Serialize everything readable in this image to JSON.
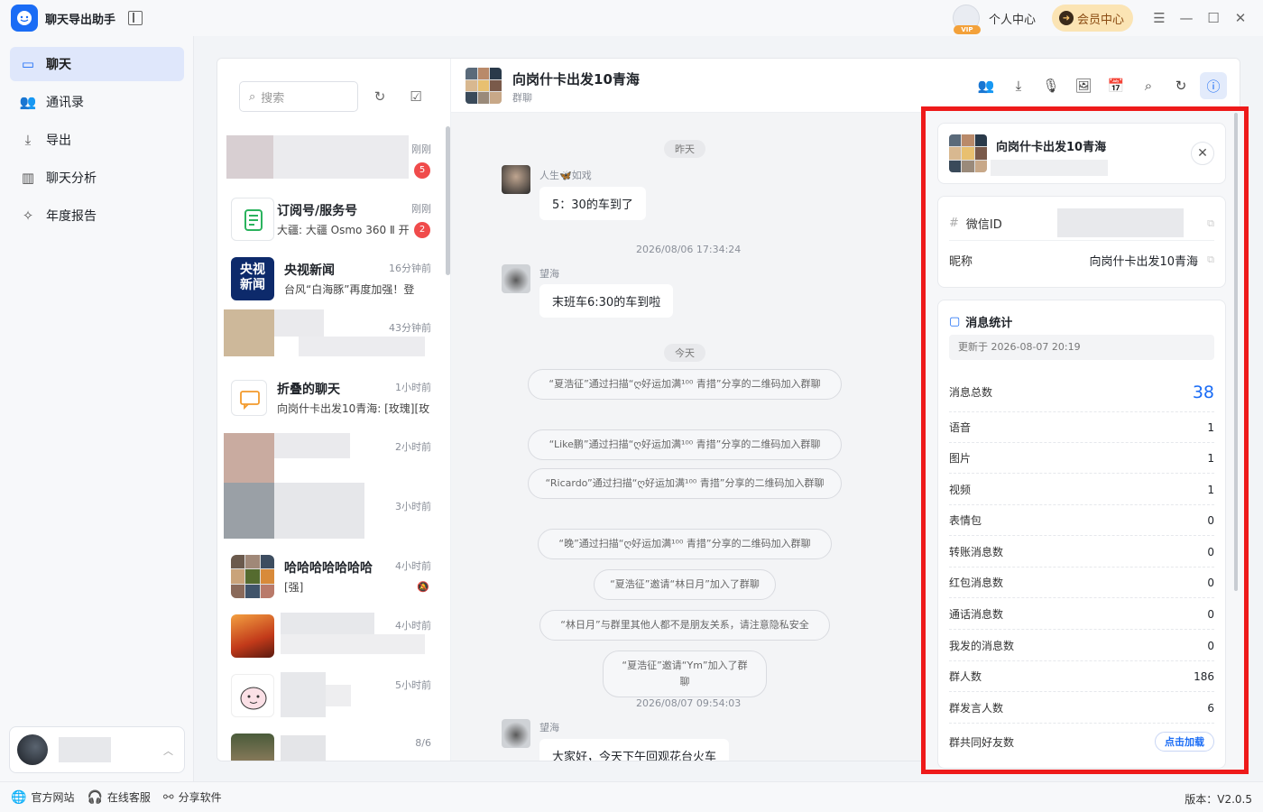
{
  "app": {
    "title": "聊天导出助手"
  },
  "titlebar": {
    "personal": "个人中心",
    "member": "会员中心",
    "vip": "VIP"
  },
  "nav": [
    {
      "label": "聊天",
      "icon": "chat-icon"
    },
    {
      "label": "通讯录",
      "icon": "contacts-icon"
    },
    {
      "label": "导出",
      "icon": "export-icon"
    },
    {
      "label": "聊天分析",
      "icon": "chart-icon"
    },
    {
      "label": "年度报告",
      "icon": "sparkle-icon"
    }
  ],
  "bottom": {
    "site": "官方网站",
    "support": "在线客服",
    "share": "分享软件",
    "version": "版本：V2.0.5"
  },
  "search": {
    "placeholder": "搜索"
  },
  "chats": [
    {
      "name": "",
      "msg": "",
      "time": "刚刚",
      "badge": "5"
    },
    {
      "name": "订阅号/服务号",
      "msg": "大疆: 大疆 Osmo 360 Ⅱ 开",
      "time": "刚刚",
      "badge": "2"
    },
    {
      "name": "央视新闻",
      "msg": "台风“白海豚”再度加强！登",
      "time": "16分钟前",
      "logo": "央视\n新闻"
    },
    {
      "name": "",
      "msg": "",
      "time": "43分钟前"
    },
    {
      "name": "折叠的聊天",
      "msg": "向岗什卡出发10青海: [玫瑰][玫",
      "time": "1小时前"
    },
    {
      "name": "",
      "msg": "",
      "time": "2小时前"
    },
    {
      "name": "",
      "msg": "",
      "time": "3小时前"
    },
    {
      "name": "哈哈哈哈哈哈哈",
      "msg": "[强]",
      "time": "4小时前"
    },
    {
      "name": "",
      "msg": "",
      "time": "4小时前"
    },
    {
      "name": "",
      "msg": "",
      "time": "5小时前"
    },
    {
      "name": "",
      "msg": "",
      "time": "8/6"
    }
  ],
  "chat": {
    "title": "向岗什卡出发10青海",
    "subtitle": "群聊",
    "day1": "昨天",
    "msg1_name": "人生🦋如戏",
    "msg1_text": "5：30的车到了",
    "ts1": "2026/08/06 17:34:24",
    "msg2_name": "望海",
    "msg2_text": "末班车6:30的车到啦",
    "day2": "今天",
    "sys1": "“夏浩征”通过扫描“ღ好运加满¹⁰⁰ 青措”分享的二维码加入群聊",
    "sys2": "“Like鹏”通过扫描“ღ好运加满¹⁰⁰ 青措”分享的二维码加入群聊",
    "sys3": "“Ricardo”通过扫描“ღ好运加满¹⁰⁰ 青措”分享的二维码加入群聊",
    "sys4": "“晚”通过扫描“ღ好运加满¹⁰⁰ 青措”分享的二维码加入群聊",
    "sys5": "“夏浩征”邀请“林日月”加入了群聊",
    "sys6": "“林日月”与群里其他人都不是朋友关系，请注意隐私安全",
    "sys7": "“夏浩征”邀请“Ym”加入了群聊",
    "ts2": "2026/08/07 09:54:03",
    "msg3_name": "望海",
    "msg3_text": "大家好，今天下午回观花台火车"
  },
  "info": {
    "name": "向岗什卡出发10青海",
    "wechat_label": "微信ID",
    "nick_label": "昵称",
    "nick_value": "向岗什卡出发10青海",
    "stats_title": "消息统计",
    "updated": "更新于 2026-08-07 20:19",
    "total_label": "消息总数",
    "total_value": "38",
    "rows": [
      {
        "label": "语音",
        "value": "1"
      },
      {
        "label": "图片",
        "value": "1"
      },
      {
        "label": "视频",
        "value": "1"
      },
      {
        "label": "表情包",
        "value": "0"
      },
      {
        "label": "转账消息数",
        "value": "0"
      },
      {
        "label": "红包消息数",
        "value": "0"
      },
      {
        "label": "通话消息数",
        "value": "0"
      },
      {
        "label": "我发的消息数",
        "value": "0"
      },
      {
        "label": "群人数",
        "value": "186"
      },
      {
        "label": "群发言人数",
        "value": "6"
      }
    ],
    "common_label": "群共同好友数",
    "load_btn": "点击加载"
  }
}
